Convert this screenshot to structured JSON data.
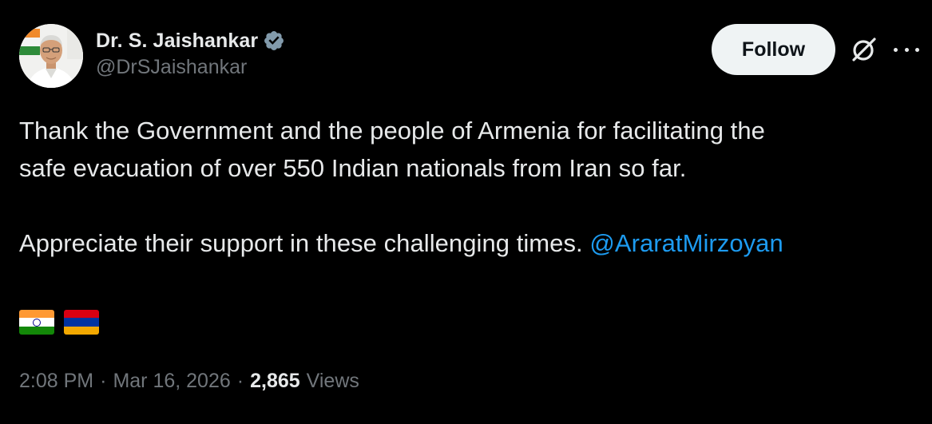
{
  "author": {
    "display_name": "Dr. S. Jaishankar",
    "handle": "@DrSJaishankar",
    "verified_color": "#829aab"
  },
  "header": {
    "follow_label": "Follow",
    "grok_icon": "grok-icon",
    "more_icon": "more-icon"
  },
  "tweet": {
    "line1": "Thank the Government and the people of Armenia for facilitating the",
    "line2": "safe evacuation of over 550 Indian nationals from Iran so far.",
    "line3_text": "Appreciate their support in these challenging times. ",
    "mention": "@AraratMirzoyan",
    "flags": [
      {
        "name": "india-flag",
        "colors": [
          "#ff9933",
          "#ffffff",
          "#138808"
        ]
      },
      {
        "name": "armenia-flag",
        "colors": [
          "#d90012",
          "#0033a0",
          "#f2a800"
        ]
      }
    ]
  },
  "meta": {
    "time": "2:08 PM",
    "separator": "·",
    "date": "Mar 16, 2026",
    "views_count": "2,865",
    "views_label": "Views"
  },
  "colors": {
    "background": "#000000",
    "text": "#e7e9ea",
    "muted": "#71767b",
    "link": "#1d9bf0",
    "follow_bg": "#eff3f4"
  }
}
